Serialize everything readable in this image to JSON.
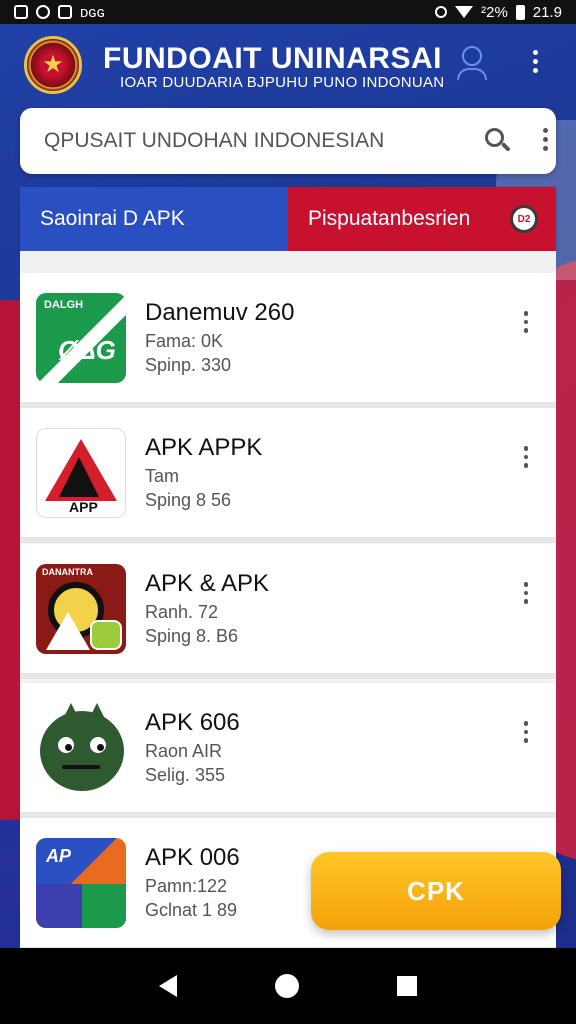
{
  "status_bar": {
    "left_text": "ᴅɢɢ",
    "battery": "²2%",
    "time": "21.9"
  },
  "header": {
    "title": "FUNDOAIT UNINARSAI",
    "subtitle": "IOAR DUUDARIA BJPUHU PUNO INDONUAN"
  },
  "search": {
    "placeholder": "QPUSAIT UNDOHAN INDONESIAN"
  },
  "tabs": [
    {
      "label": "Saoinrai D APK"
    },
    {
      "label": "Pispuatanbesrien",
      "badge": "D2"
    }
  ],
  "apps": [
    {
      "name": "Danemuv 260",
      "line1": "Fama: 0K",
      "line2": "Spinp. 330",
      "icon": "green-flag-app-icon",
      "icon_text": "DALGH",
      "icon_big": "ØΔG"
    },
    {
      "name": "APK APPK",
      "line1": "Tam",
      "line2": "Sping 8 56",
      "icon": "red-triangle-app-icon",
      "icon_text": "APP"
    },
    {
      "name": "APK & APK",
      "line1": "Ranh. 72",
      "line2": "Sping 8. B6",
      "icon": "gear-warning-app-icon",
      "icon_text": "DANANTRA"
    },
    {
      "name": "APK 606",
      "line1": "Raon AIR",
      "line2": "Selig. 355",
      "icon": "green-monster-app-icon"
    },
    {
      "name": "APK 006",
      "line1": "Pamn:122",
      "line2": "Gclnat 1 89",
      "icon": "colorful-ap-app-icon",
      "icon_text": "AP"
    }
  ],
  "cta": {
    "label": "CPK"
  },
  "colors": {
    "brand_blue": "#2a4fc0",
    "brand_red": "#c8112f",
    "cta_yellow": "#f4a20a",
    "title_yellow": "#ffd600"
  }
}
